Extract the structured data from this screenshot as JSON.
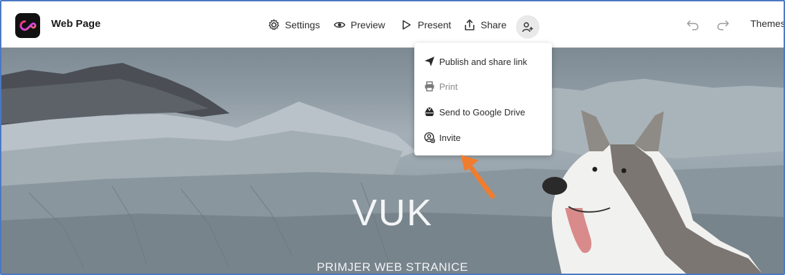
{
  "app": {
    "title": "Web Page"
  },
  "toolbar": {
    "settings": "Settings",
    "preview": "Preview",
    "present": "Present",
    "share": "Share",
    "themes": "Themes"
  },
  "share_menu": {
    "items": [
      {
        "label": "Publish and share link",
        "icon": "paper-plane-icon",
        "enabled": true
      },
      {
        "label": "Print",
        "icon": "printer-icon",
        "enabled": false
      },
      {
        "label": "Send to Google Drive",
        "icon": "google-drive-icon",
        "enabled": true
      },
      {
        "label": "Invite",
        "icon": "invite-user-icon",
        "enabled": true
      }
    ]
  },
  "hero": {
    "title": "VUK",
    "subtitle": "PRIMJER WEB STRANICE"
  },
  "colors": {
    "accent_arrow": "#f07d2e",
    "frame_border": "#4a78c4",
    "hero_text": "#f3f5f7"
  }
}
